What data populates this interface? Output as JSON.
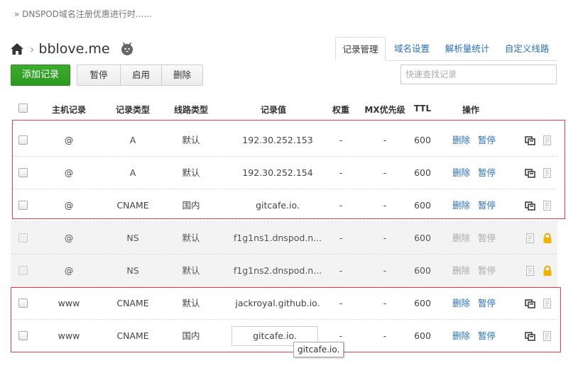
{
  "notice": "» DNSPOD域名注册优惠进行时......",
  "breadcrumb": {
    "separator": "›",
    "domain": "bblove.me"
  },
  "tabs": [
    {
      "label": "记录管理",
      "active": true
    },
    {
      "label": "域名设置",
      "active": false
    },
    {
      "label": "解析量统计",
      "active": false
    },
    {
      "label": "自定义线路",
      "active": false
    }
  ],
  "toolbar": {
    "add_label": "添加记录",
    "pause_label": "暂停",
    "enable_label": "启用",
    "delete_label": "删除"
  },
  "search": {
    "placeholder": "快速查找记录",
    "value": ""
  },
  "table": {
    "headers": {
      "host": "主机记录",
      "type": "记录类型",
      "line": "线路类型",
      "value": "记录值",
      "weight": "权重",
      "mx": "MX优先级",
      "ttl": "TTL",
      "ops": "操作"
    },
    "op_delete": "删除",
    "op_pause": "暂停",
    "rows": [
      {
        "host": "@",
        "type": "A",
        "line": "默认",
        "value": "192.30.252.153",
        "weight": "-",
        "mx": "-",
        "ttl": "600",
        "system": false
      },
      {
        "host": "@",
        "type": "A",
        "line": "默认",
        "value": "192.30.252.154",
        "weight": "-",
        "mx": "-",
        "ttl": "600",
        "system": false
      },
      {
        "host": "@",
        "type": "CNAME",
        "line": "国内",
        "value": "gitcafe.io.",
        "weight": "-",
        "mx": "-",
        "ttl": "600",
        "system": false
      },
      {
        "host": "@",
        "type": "NS",
        "line": "默认",
        "value": "f1g1ns1.dnspod.n...",
        "weight": "-",
        "mx": "-",
        "ttl": "600",
        "system": true
      },
      {
        "host": "@",
        "type": "NS",
        "line": "默认",
        "value": "f1g1ns2.dnspod.n...",
        "weight": "-",
        "mx": "-",
        "ttl": "600",
        "system": true
      },
      {
        "host": "www",
        "type": "CNAME",
        "line": "默认",
        "value": "jackroyal.github.io.",
        "weight": "-",
        "mx": "-",
        "ttl": "600",
        "system": false
      },
      {
        "host": "www",
        "type": "CNAME",
        "line": "国内",
        "value": "gitcafe.io.",
        "weight": "-",
        "mx": "-",
        "ttl": "600",
        "system": false
      }
    ]
  },
  "tooltip": "gitcafe.io.",
  "colors": {
    "accent_green": "#2c9a22",
    "link_blue": "#2a6fb8",
    "highlight_red": "#d9414c",
    "lock_yellow": "#f0b400"
  }
}
